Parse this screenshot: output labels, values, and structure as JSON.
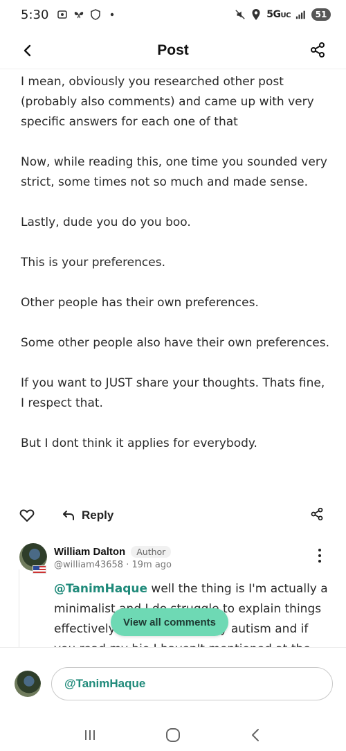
{
  "status_bar": {
    "time": "5:30",
    "network": "5G",
    "network_sub": "UC",
    "battery": "51"
  },
  "header": {
    "title": "Post"
  },
  "post": {
    "paragraphs": [
      "I mean, obviously you researched other post (probably also comments) and came up with very specific answers for each one of that",
      "Now, while reading this, one time you sounded very strict, some times not so much and made sense.",
      "Lastly,  dude you do you boo.",
      "This is your preferences.",
      "Other people has their own preferences.",
      "Some other people also have their own preferences.",
      "If you want to JUST share your thoughts. Thats fine, I respect that.",
      "But I dont think it applies for everybody."
    ],
    "reply_label": "Reply"
  },
  "comment": {
    "author": "William Dalton",
    "badge": "Author",
    "handle": "@william43658",
    "time": "19m ago",
    "meta_separator": " · ",
    "mention": "@TanimHaque",
    "text": " well the thing is I'm actually a minimalist and I do struggle to explain things effectively and it's part of my autism and if you read my bio I haven't mentioned at the"
  },
  "view_all_label": "View all comments",
  "composer": {
    "value": "@TanimHaque"
  },
  "icons": {
    "back": "chevron-left-icon",
    "share": "share-icon",
    "heart": "heart-icon",
    "reply": "reply-arrow-icon",
    "more": "kebab-menu-icon"
  },
  "colors": {
    "accent": "#1f8a7a",
    "view_all_bg": "#6ed9b4"
  }
}
